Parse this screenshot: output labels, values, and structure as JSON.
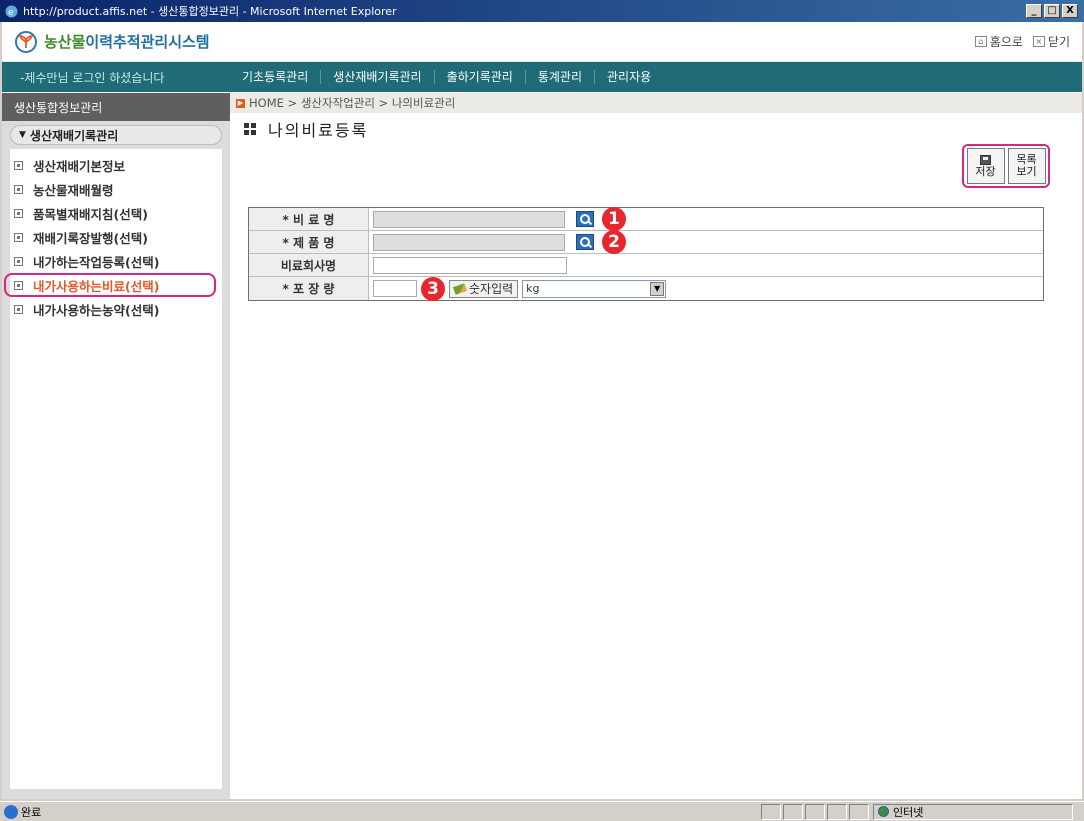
{
  "window": {
    "title": "http://product.affis.net - 생산통합정보관리 - Microsoft Internet Explorer",
    "controls": [
      "_",
      "□",
      "X"
    ]
  },
  "header": {
    "logo_prefix": "농산물",
    "logo_suffix": "이력추적관리시스템",
    "home_label": "홈으로",
    "close_label": "닫기"
  },
  "topnav": {
    "login_message": "-제수만님 로그인 하셨습니다",
    "menu": [
      "기초등록관리",
      "생산재배기록관리",
      "출하기록관리",
      "통계관리",
      "관리자용"
    ]
  },
  "sidebar": {
    "title": "생산통합정보관리",
    "section": "생산재배기록관리",
    "items": [
      {
        "label": "생산재배기본정보"
      },
      {
        "label": "농산물재배월령"
      },
      {
        "label": "품목별재배지침(선택)"
      },
      {
        "label": "재배기록장발행(선택)"
      },
      {
        "label": "내가하는작업등록(선택)"
      },
      {
        "label": "내가사용하는비료(선택)"
      },
      {
        "label": "내가사용하는농약(선택)"
      }
    ],
    "active_index": 5
  },
  "breadcrumb": "HOME > 생산자작업관리 > 나의비료관리",
  "page_title": "나의비료등록",
  "actions": {
    "save_label": "저장",
    "list_label_1": "목록",
    "list_label_2": "보기"
  },
  "form": {
    "fertilizer_name_label": "* 비 료 명",
    "product_name_label": "* 제 품 명",
    "company_label": "비료회사명",
    "package_label": "* 포 장 량",
    "numeric_input_label": "숫자입력",
    "unit_selected": "kg",
    "markers": [
      "1",
      "2",
      "3"
    ]
  },
  "statusbar": {
    "status": "완료",
    "zone": "인터넷"
  }
}
